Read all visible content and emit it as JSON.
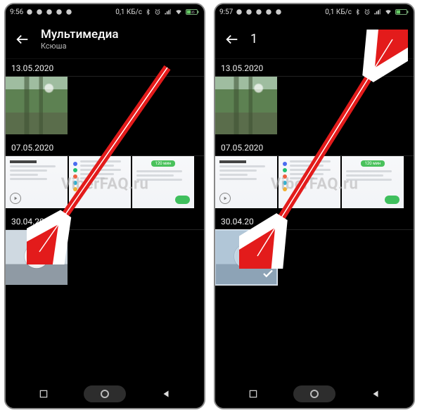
{
  "status": {
    "time_left": "9:56",
    "time_right": "9:57",
    "net_speed": "0,1 КБ/с",
    "battery_left": "35",
    "battery_right": "35"
  },
  "screen_left": {
    "title": "Мультимедиа",
    "subtitle": "Ксюша",
    "sections": [
      {
        "date": "13.05.2020"
      },
      {
        "date": "07.05.2020",
        "card3_badge": "120 мин"
      },
      {
        "date": "30.04.2020"
      }
    ]
  },
  "screen_right": {
    "selected_count": "1",
    "sections": [
      {
        "date": "13.05.2020"
      },
      {
        "date": "07.05.2020",
        "card3_badge": "120 мин"
      },
      {
        "date": "30.04.20"
      }
    ]
  },
  "watermark": "ViberFAQ.ru",
  "colors": {
    "arrow": "#e31b1b",
    "arrow_stroke": "#ffffff"
  }
}
